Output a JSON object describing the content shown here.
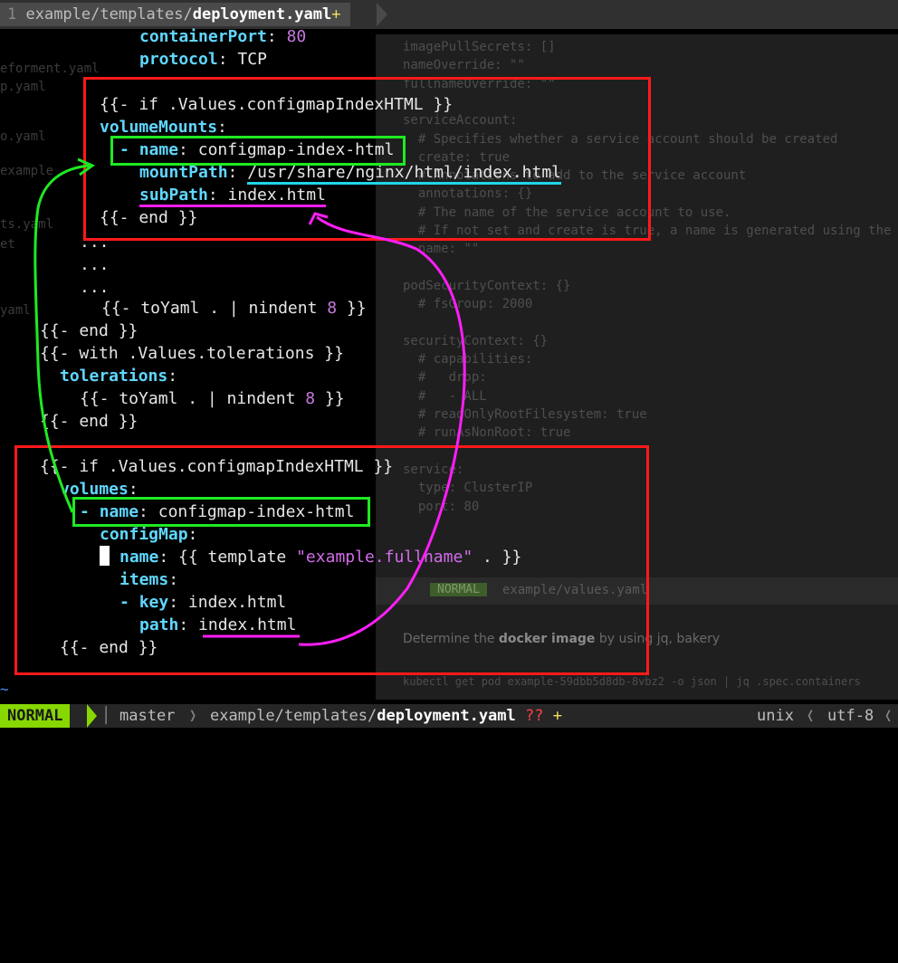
{
  "tabline": {
    "tab_number": "1",
    "tab_path": " example/templates/",
    "tab_file": "deployment.yaml",
    "tab_modified": "+"
  },
  "background_window": {
    "lines": [
      "imagePullSecrets: []",
      "nameOverride: \"\"",
      "fullnameOverride: \"\"",
      "",
      "serviceAccount:",
      "  # Specifies whether a service account should be created",
      "  create: true",
      "  # Annotations to add to the service account",
      "  annotations: {}",
      "  # The name of the service account to use.",
      "  # If not set and create is true, a name is generated using the fullname template",
      "  name: \"\"",
      "",
      "podSecurityContext: {}",
      "  # fsGroup: 2000",
      "",
      "securityContext: {}",
      "  # capabilities:",
      "  #   drop:",
      "  #   - ALL",
      "  # readOnlyRootFilesystem: true",
      "  # runAsNonRoot: true",
      "",
      "service:",
      "  type: ClusterIP",
      "  port: 80"
    ],
    "badge_text": "NORMAL",
    "badge_path": "example/values.yaml",
    "prose_before": "Determine the ",
    "prose_bold": "docker image",
    "prose_after": " by using jq, bakery",
    "shell_line": "kubectl get pod example-59dbb5d8db-8vbz2 -o json | jq .spec.containers"
  },
  "ghost_left": [
    "eforment.yaml",
    "p.yaml",
    "o.yaml",
    "example",
    "ts.yaml",
    "et",
    "yaml"
  ],
  "code": {
    "l1": {
      "key": "containerPort",
      "colon": ": ",
      "value": "80"
    },
    "l2": {
      "key": "protocol",
      "colon": ": ",
      "value": "TCP"
    },
    "l3": {
      "text": "{{- if .Values.configmapIndexHTML }}"
    },
    "l4": {
      "key": "volumeMounts",
      "colon": ":"
    },
    "l5": {
      "dash": "- ",
      "key": "name",
      "colon": ": ",
      "value": "configmap-index-html"
    },
    "l6": {
      "key": "mountPath",
      "colon": ": ",
      "value": "/usr/share/nginx/html/index.html"
    },
    "l7": {
      "key": "subPath",
      "colon": ": ",
      "value": "index.html"
    },
    "l8": {
      "text": "{{- end }}"
    },
    "l9": {
      "text": "..."
    },
    "l10": {
      "text": "..."
    },
    "l11": {
      "text": "..."
    },
    "l12": {
      "pre": "{{- toYaml . | nindent ",
      "num": "8",
      "post": " }}"
    },
    "l13": {
      "text": "{{- end }}"
    },
    "l14": {
      "text": "{{- with .Values.tolerations }}"
    },
    "l15": {
      "key": "tolerations",
      "colon": ":"
    },
    "l16": {
      "pre": "{{- toYaml . | nindent ",
      "num": "8",
      "post": " }}"
    },
    "l17": {
      "text": "{{- end }}"
    },
    "l18": {
      "text": "{{- if .Values.configmapIndexHTML }}"
    },
    "l19": {
      "key": "volumes",
      "colon": ":"
    },
    "l20": {
      "dash": "- ",
      "key": "name",
      "colon": ": ",
      "value": "configmap-index-html"
    },
    "l21": {
      "key": "configMap",
      "colon": ":"
    },
    "l22": {
      "key": "name",
      "colon": ": ",
      "pre": "{{ template ",
      "str": "\"example.fullname\"",
      "post": " . }}"
    },
    "l23": {
      "key": "items",
      "colon": ":"
    },
    "l24": {
      "dash": "- ",
      "key": "key",
      "colon": ": ",
      "value": "index.html"
    },
    "l25": {
      "key": "path",
      "colon": ": ",
      "value": "index.html"
    },
    "l26": {
      "text": "{{- end }}"
    }
  },
  "tilde": "~",
  "statusline": {
    "mode": "NORMAL",
    "branch_icon": "branch-icon",
    "branch": "master",
    "path_dir": "example/templates/",
    "path_file": "deployment.yaml",
    "flags_unknown": "??",
    "flags_modified": "+",
    "fileformat": "unix",
    "encoding": "utf-8"
  },
  "colors": {
    "key": "#5fd7ff",
    "number": "#c678dd",
    "annotation_red": "#ff1a1a",
    "annotation_green": "#1eea22",
    "annotation_magenta": "#ff1ef8",
    "annotation_cyan": "#1fd6e8",
    "mode_green": "#87d700"
  }
}
